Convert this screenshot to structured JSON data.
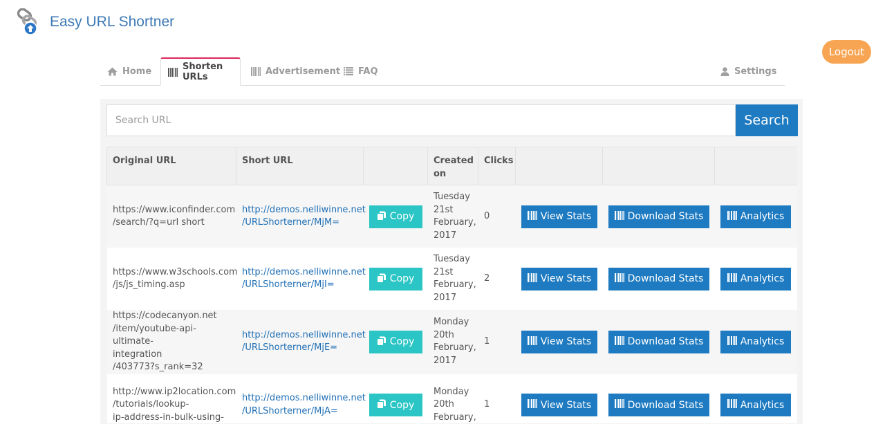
{
  "app": {
    "title": "Easy URL Shortner",
    "logout_label": "Logout"
  },
  "tabs": [
    {
      "label": "Home",
      "icon": "home-icon"
    },
    {
      "label": "Shorten URLs",
      "icon": "barcode-icon",
      "active": true
    },
    {
      "label": "Advertisement",
      "icon": "barcode-icon"
    },
    {
      "label": "FAQ",
      "icon": "list-icon"
    },
    {
      "label": "Settings",
      "icon": "user-icon"
    }
  ],
  "search": {
    "placeholder": "Search URL",
    "button_label": "Search"
  },
  "table": {
    "headers": {
      "original": "Original URL",
      "short": "Short URL",
      "copy": "",
      "created": "Created on",
      "clicks": "Clicks",
      "view": "",
      "download": "",
      "analytics": ""
    },
    "actions": {
      "copy": "Copy",
      "view_stats": "View Stats",
      "download_stats": "Download Stats",
      "analytics": "Analytics"
    },
    "rows": [
      {
        "original": [
          "https://www.iconfinder.com",
          "/search/?q=url short"
        ],
        "short": [
          "http://demos.nelliwinne.net",
          "/URLShorterner/MjM="
        ],
        "created": [
          "Tuesday",
          "21st",
          "February,",
          "2017"
        ],
        "clicks": "0"
      },
      {
        "original": [
          "https://www.w3schools.com",
          "/js/js_timing.asp"
        ],
        "short": [
          "http://demos.nelliwinne.net",
          "/URLShorterner/MjI="
        ],
        "created": [
          "Tuesday",
          "21st",
          "February,",
          "2017"
        ],
        "clicks": "2"
      },
      {
        "original": [
          "https://codecanyon.net",
          "/item/youtube-api-ultimate-",
          "integration",
          "/403773?s_rank=32"
        ],
        "short": [
          "http://demos.nelliwinne.net",
          "/URLShorterner/MjE="
        ],
        "created": [
          "Monday",
          "20th",
          "February,",
          "2017"
        ],
        "clicks": "1"
      },
      {
        "original": [
          "http://www.ip2location.com",
          "/tutorials/lookup-",
          "ip-address-in-bulk-using-"
        ],
        "short": [
          "http://demos.nelliwinne.net",
          "/URLShorterner/MjA="
        ],
        "created": [
          "Monday",
          "20th",
          "February,"
        ],
        "clicks": "1"
      }
    ]
  },
  "colors": {
    "brand": "#3d79b6",
    "logout": "#f7a553",
    "primary": "#1f7bc1",
    "copy": "#2bc5c5",
    "active_tab_border": "#e0245e"
  }
}
